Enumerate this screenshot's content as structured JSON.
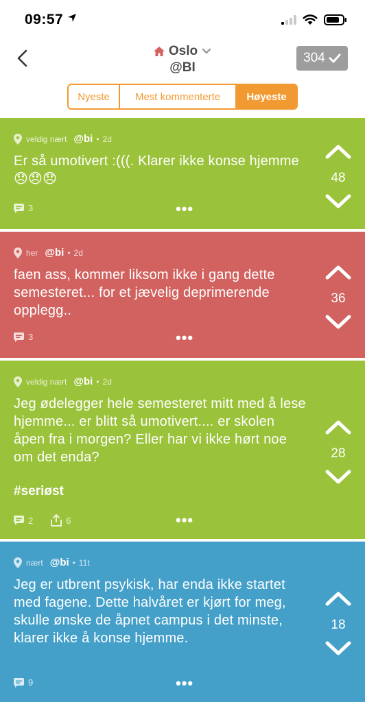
{
  "status": {
    "time": "09:57"
  },
  "header": {
    "title": "Oslo",
    "subtitle": "@BI",
    "karma": "304",
    "tabs": [
      {
        "label": "Nyeste",
        "active": false
      },
      {
        "label": "Mest kommenterte",
        "active": false
      },
      {
        "label": "Høyeste",
        "active": true
      }
    ]
  },
  "posts": [
    {
      "location": "veldig nært",
      "handle": "@bi",
      "time": "2d",
      "text": "Er så umotivert :(((. Klarer ikke konse hjemme 😞😞😞",
      "comments": "3",
      "score": "48",
      "color": "#9ac23a"
    },
    {
      "location": "her",
      "handle": "@bi",
      "time": "2d",
      "text": "faen ass, kommer liksom ikke i gang dette semesteret... for et jævelig deprimerende opplegg..",
      "comments": "3",
      "score": "36",
      "color": "#d1625f"
    },
    {
      "location": "veldig nært",
      "handle": "@bi",
      "time": "2d",
      "text": "Jeg ødelegger hele semesteret mitt med å lese hjemme... er blitt så umotivert.... er skolen åpen fra i morgen? Eller har vi ikke hørt noe om det enda?",
      "hashtag": "#seriøst",
      "comments": "2",
      "shares": "6",
      "score": "28",
      "color": "#9ac23a"
    },
    {
      "location": "nært",
      "handle": "@bi",
      "time": "11t",
      "text": "Jeg er utbrent psykisk, har enda ikke startet med fagene. Dette halvåret er kjørt for meg, skulle ønske de åpnet campus i det minste, klarer ikke å konse hjemme.",
      "comments": "9",
      "score": "18",
      "color": "#44a0c9"
    }
  ]
}
